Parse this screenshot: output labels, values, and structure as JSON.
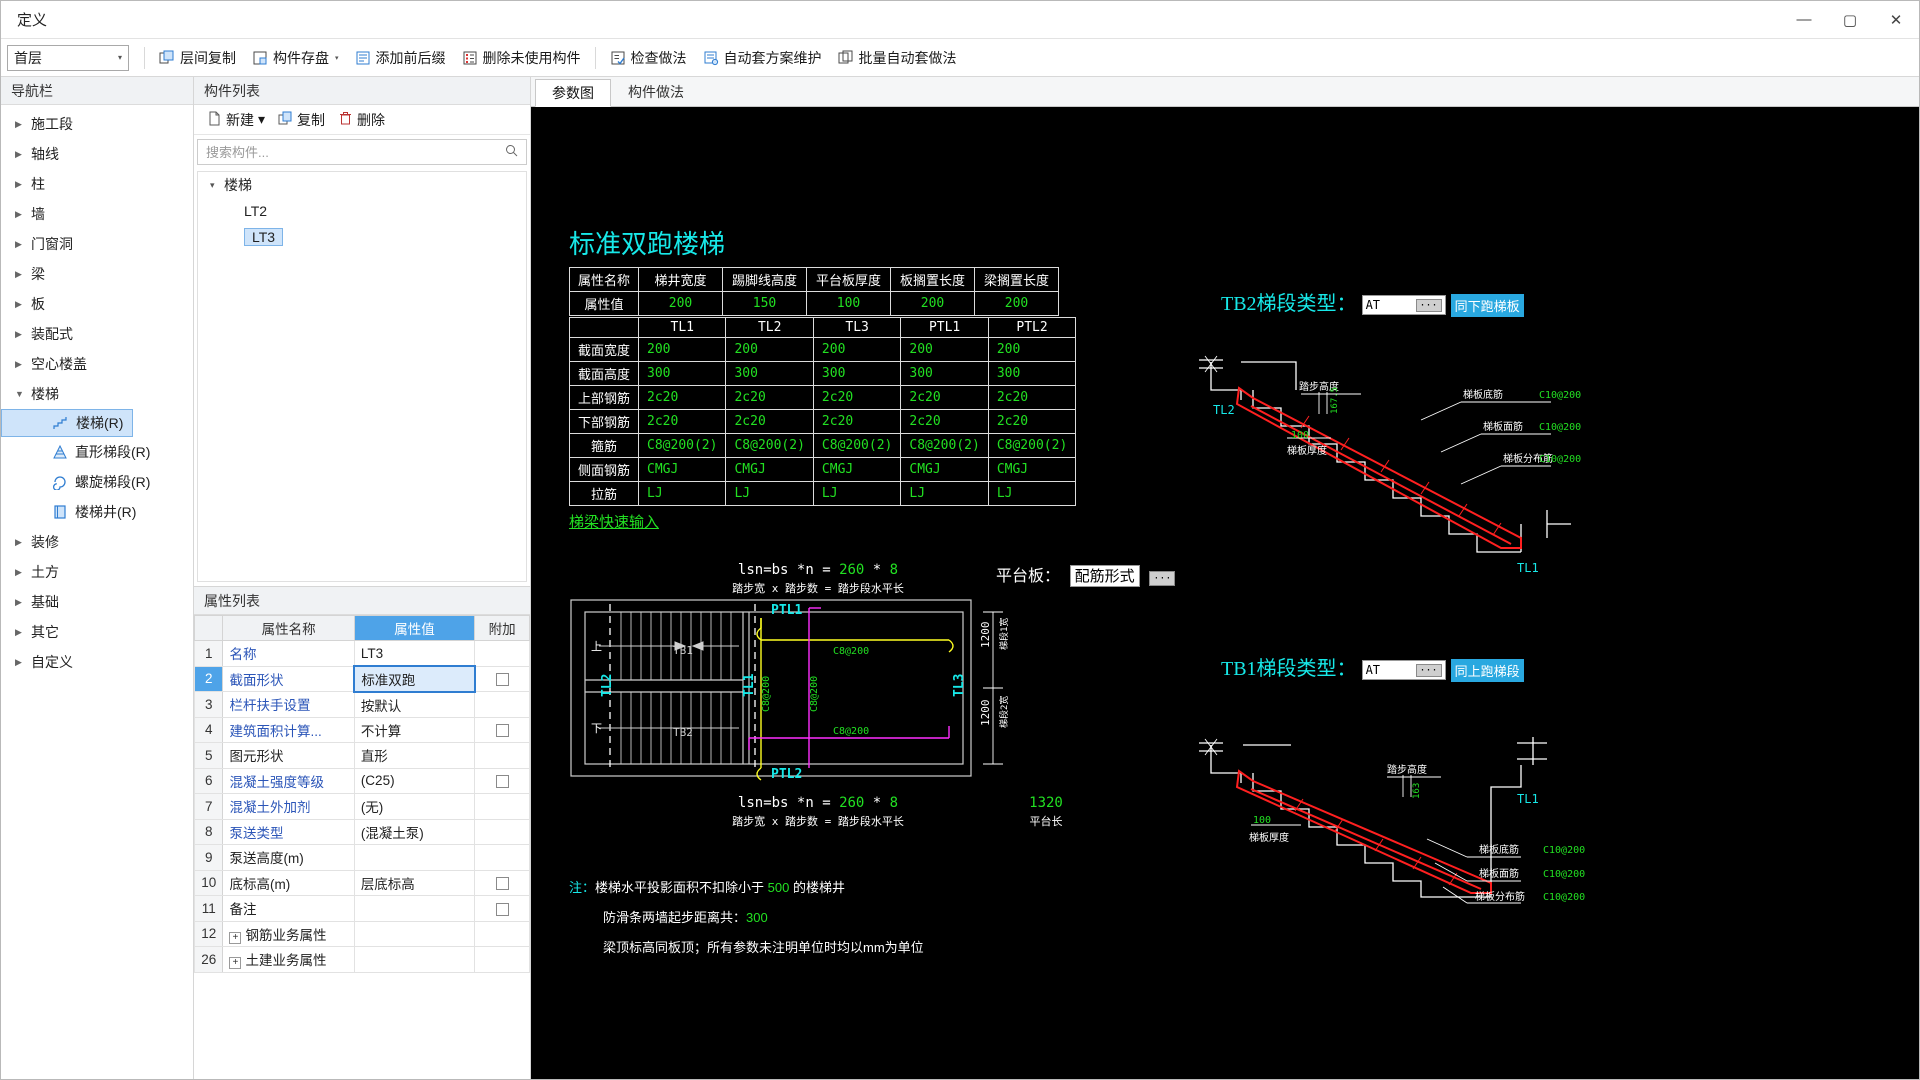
{
  "window": {
    "title": "定义",
    "minimize": "—",
    "maximize": "▢",
    "close": "✕"
  },
  "toolbar": {
    "floor_selector": {
      "value": "首层",
      "caret": "▾"
    },
    "buttons": [
      {
        "name": "copy-between-floors",
        "label": "层间复制",
        "icon": "copy-icon",
        "caret": ""
      },
      {
        "name": "component-save",
        "label": "构件存盘",
        "icon": "save-icon",
        "caret": "▾"
      },
      {
        "name": "add-prefix-suffix",
        "label": "添加前后缀",
        "icon": "list-icon",
        "caret": ""
      },
      {
        "name": "delete-unused-components",
        "label": "删除未使用构件",
        "icon": "delete-list-icon",
        "caret": ""
      },
      {
        "name": "check-method",
        "label": "检查做法",
        "icon": "check-icon",
        "caret": ""
      },
      {
        "name": "auto-plan-maintenance",
        "label": "自动套方案维护",
        "icon": "auto-icon",
        "caret": ""
      },
      {
        "name": "batch-auto-method",
        "label": "批量自动套做法",
        "icon": "batch-icon",
        "caret": ""
      }
    ]
  },
  "sidebar": {
    "header": "导航栏",
    "items": [
      {
        "label": "施工段",
        "expanded": false,
        "level": 0
      },
      {
        "label": "轴线",
        "expanded": false,
        "level": 0
      },
      {
        "label": "柱",
        "expanded": false,
        "level": 0
      },
      {
        "label": "墙",
        "expanded": false,
        "level": 0
      },
      {
        "label": "门窗洞",
        "expanded": false,
        "level": 0
      },
      {
        "label": "梁",
        "expanded": false,
        "level": 0
      },
      {
        "label": "板",
        "expanded": false,
        "level": 0
      },
      {
        "label": "装配式",
        "expanded": false,
        "level": 0
      },
      {
        "label": "空心楼盖",
        "expanded": false,
        "level": 0
      },
      {
        "label": "楼梯",
        "expanded": true,
        "level": 0
      }
    ],
    "stair_children": [
      {
        "label": "楼梯(R)",
        "icon": "stair-icon",
        "selected": true
      },
      {
        "label": "直形梯段(R)",
        "icon": "straight-flight-icon",
        "selected": false
      },
      {
        "label": "螺旋梯段(R)",
        "icon": "spiral-flight-icon",
        "selected": false
      },
      {
        "label": "楼梯井(R)",
        "icon": "stairwell-icon",
        "selected": false
      }
    ],
    "items_after": [
      {
        "label": "装修",
        "expanded": false,
        "level": 0
      },
      {
        "label": "土方",
        "expanded": false,
        "level": 0
      },
      {
        "label": "基础",
        "expanded": false,
        "level": 0
      },
      {
        "label": "其它",
        "expanded": false,
        "level": 0
      },
      {
        "label": "自定义",
        "expanded": false,
        "level": 0
      }
    ]
  },
  "component_list": {
    "header": "构件列表",
    "actions": [
      {
        "name": "new-button",
        "label": "新建",
        "icon": "new-file-icon",
        "caret": "▾"
      },
      {
        "name": "copy-button",
        "label": "复制",
        "icon": "copy-icon",
        "caret": ""
      },
      {
        "name": "delete-button",
        "label": "删除",
        "icon": "trash-icon",
        "caret": ""
      }
    ],
    "search_placeholder": "搜索构件...",
    "search_value": "",
    "tree": {
      "group": "楼梯",
      "expanded": "▾",
      "items": [
        {
          "label": "LT2",
          "selected": false
        },
        {
          "label": "LT3",
          "selected": true
        }
      ]
    }
  },
  "property_list": {
    "header": "属性列表",
    "columns": [
      "",
      "属性名称",
      "属性值",
      "附加"
    ],
    "rows": [
      {
        "idx": "1",
        "name": "名称",
        "value": "LT3",
        "blue": true,
        "attach": false,
        "selected": false,
        "editing": false,
        "expand": false
      },
      {
        "idx": "2",
        "name": "截面形状",
        "value": "标准双跑",
        "blue": true,
        "attach": true,
        "selected": true,
        "editing": true,
        "expand": false
      },
      {
        "idx": "3",
        "name": "栏杆扶手设置",
        "value": "按默认",
        "blue": true,
        "attach": false,
        "selected": false,
        "editing": false,
        "expand": false
      },
      {
        "idx": "4",
        "name": "建筑面积计算...",
        "value": "不计算",
        "blue": true,
        "attach": true,
        "selected": false,
        "editing": false,
        "expand": false
      },
      {
        "idx": "5",
        "name": "图元形状",
        "value": "直形",
        "blue": false,
        "attach": false,
        "selected": false,
        "editing": false,
        "expand": false
      },
      {
        "idx": "6",
        "name": "混凝土强度等级",
        "value": "(C25)",
        "blue": true,
        "attach": true,
        "selected": false,
        "editing": false,
        "expand": false
      },
      {
        "idx": "7",
        "name": "混凝土外加剂",
        "value": "(无)",
        "blue": true,
        "attach": false,
        "selected": false,
        "editing": false,
        "expand": false
      },
      {
        "idx": "8",
        "name": "泵送类型",
        "value": "(混凝土泵)",
        "blue": true,
        "attach": false,
        "selected": false,
        "editing": false,
        "expand": false
      },
      {
        "idx": "9",
        "name": "泵送高度(m)",
        "value": "",
        "blue": false,
        "attach": false,
        "selected": false,
        "editing": false,
        "expand": false
      },
      {
        "idx": "10",
        "name": "底标高(m)",
        "value": "层底标高",
        "blue": false,
        "attach": true,
        "selected": false,
        "editing": false,
        "expand": false
      },
      {
        "idx": "11",
        "name": "备注",
        "value": "",
        "blue": false,
        "attach": true,
        "selected": false,
        "editing": false,
        "expand": false
      },
      {
        "idx": "12",
        "name": "钢筋业务属性",
        "value": "",
        "blue": false,
        "attach": false,
        "selected": false,
        "editing": false,
        "expand": true
      },
      {
        "idx": "26",
        "name": "土建业务属性",
        "value": "",
        "blue": false,
        "attach": false,
        "selected": false,
        "editing": false,
        "expand": true
      }
    ]
  },
  "tabs": [
    {
      "label": "参数图",
      "active": true
    },
    {
      "label": "构件做法",
      "active": false
    }
  ],
  "drawing": {
    "title": "标准双跑楼梯",
    "param_table": {
      "header_label": "属性名称",
      "value_label": "属性值",
      "columns": [
        "梯井宽度",
        "踢脚线高度",
        "平台板厚度",
        "板搁置长度",
        "梁搁置长度"
      ],
      "values": [
        "200",
        "150",
        "100",
        "200",
        "200"
      ]
    },
    "beam_table": {
      "columns": [
        "TL1",
        "TL2",
        "TL3",
        "PTL1",
        "PTL2"
      ],
      "rows": [
        {
          "label": "截面宽度",
          "values": [
            "200",
            "200",
            "200",
            "200",
            "200"
          ]
        },
        {
          "label": "截面高度",
          "values": [
            "300",
            "300",
            "300",
            "300",
            "300"
          ]
        },
        {
          "label": "上部钢筋",
          "values": [
            "2c20",
            "2c20",
            "2c20",
            "2c20",
            "2c20"
          ]
        },
        {
          "label": "下部钢筋",
          "values": [
            "2c20",
            "2c20",
            "2c20",
            "2c20",
            "2c20"
          ]
        },
        {
          "label": "箍筋",
          "values": [
            "C8@200(2)",
            "C8@200(2)",
            "C8@200(2)",
            "C8@200(2)",
            "C8@200(2)"
          ]
        },
        {
          "label": "侧面钢筋",
          "values": [
            "CMGJ",
            "CMGJ",
            "CMGJ",
            "CMGJ",
            "CMGJ"
          ]
        },
        {
          "label": "拉筋",
          "values": [
            "LJ",
            "LJ",
            "LJ",
            "LJ",
            "LJ"
          ]
        }
      ]
    },
    "quick_input_link": "梯梁快速输入",
    "tb2": {
      "label": "TB2梯段类型：",
      "type_value": "AT",
      "dots": "···",
      "button": "同下跑梯板",
      "callouts": {
        "step_height": "踏步高度",
        "step_height_value": "167.5",
        "slab_thickness": "梯板厚度",
        "slab_thickness_value": "100",
        "bottom_rebar": "梯板底筋",
        "bottom_rebar_value": "C10@200",
        "top_rebar": "梯板面筋",
        "top_rebar_value": "C10@200",
        "dist_rebar": "梯板分布筋",
        "dist_rebar_value": "C10@200",
        "beam_left": "TL2",
        "beam_right": "TL1"
      }
    },
    "tb1": {
      "label": "TB1梯段类型：",
      "type_value": "AT",
      "dots": "···",
      "button": "同上跑梯段",
      "callouts": {
        "step_height": "踏步高度",
        "step_height_value": "163",
        "slab_thickness": "梯板厚度",
        "slab_thickness_value": "100",
        "bottom_rebar": "梯板底筋",
        "bottom_rebar_value": "C10@200",
        "top_rebar": "梯板面筋",
        "top_rebar_value": "C10@200",
        "dist_rebar": "梯板分布筋",
        "dist_rebar_value": "C10@200",
        "beam_right": "TL1"
      }
    },
    "plan": {
      "dim_top_formula": "lsn=bs *n = ",
      "dim_top_val1": "260",
      "dim_top_mult": " * ",
      "dim_top_val2": "8",
      "dim_top_desc": "踏步宽 x 踏步数 = 踏步段水平长",
      "dim_bottom_desc": "踏步宽 x 踏步数 = 踏步段水平长",
      "platform_label": "平台板：",
      "platform_value": "配筋形式",
      "platform_dots": "···",
      "platform_len_value": "1320",
      "platform_len_label": "平台长",
      "flight_up": "上",
      "flight_down": "下",
      "flight1": "TB1",
      "flight2": "TB2",
      "beam_left": "TL2",
      "beam_mid": "TL1",
      "beam_right": "TL3",
      "ptl1": "PTL1",
      "ptl2": "PTL2",
      "rebar_h1": "C8@200",
      "rebar_h2": "C8@200",
      "rebar_v1": "C8@200",
      "rebar_v2": "C8@200",
      "dim_right_1": "1200",
      "dim_right_1_label": "梯段1宽",
      "dim_right_2": "1200",
      "dim_right_2_label": "梯段2宽"
    },
    "notes": {
      "prefix": "注：",
      "line1_pre": "楼梯水平投影面积不扣除小于 ",
      "line1_val": "500",
      "line1_post": " 的楼梯井",
      "line2_pre": "防滑条两墙起步距离共：",
      "line2_val": "300",
      "line3": "梁顶标高同板顶；所有参数未注明单位时均以mm为单位"
    }
  }
}
